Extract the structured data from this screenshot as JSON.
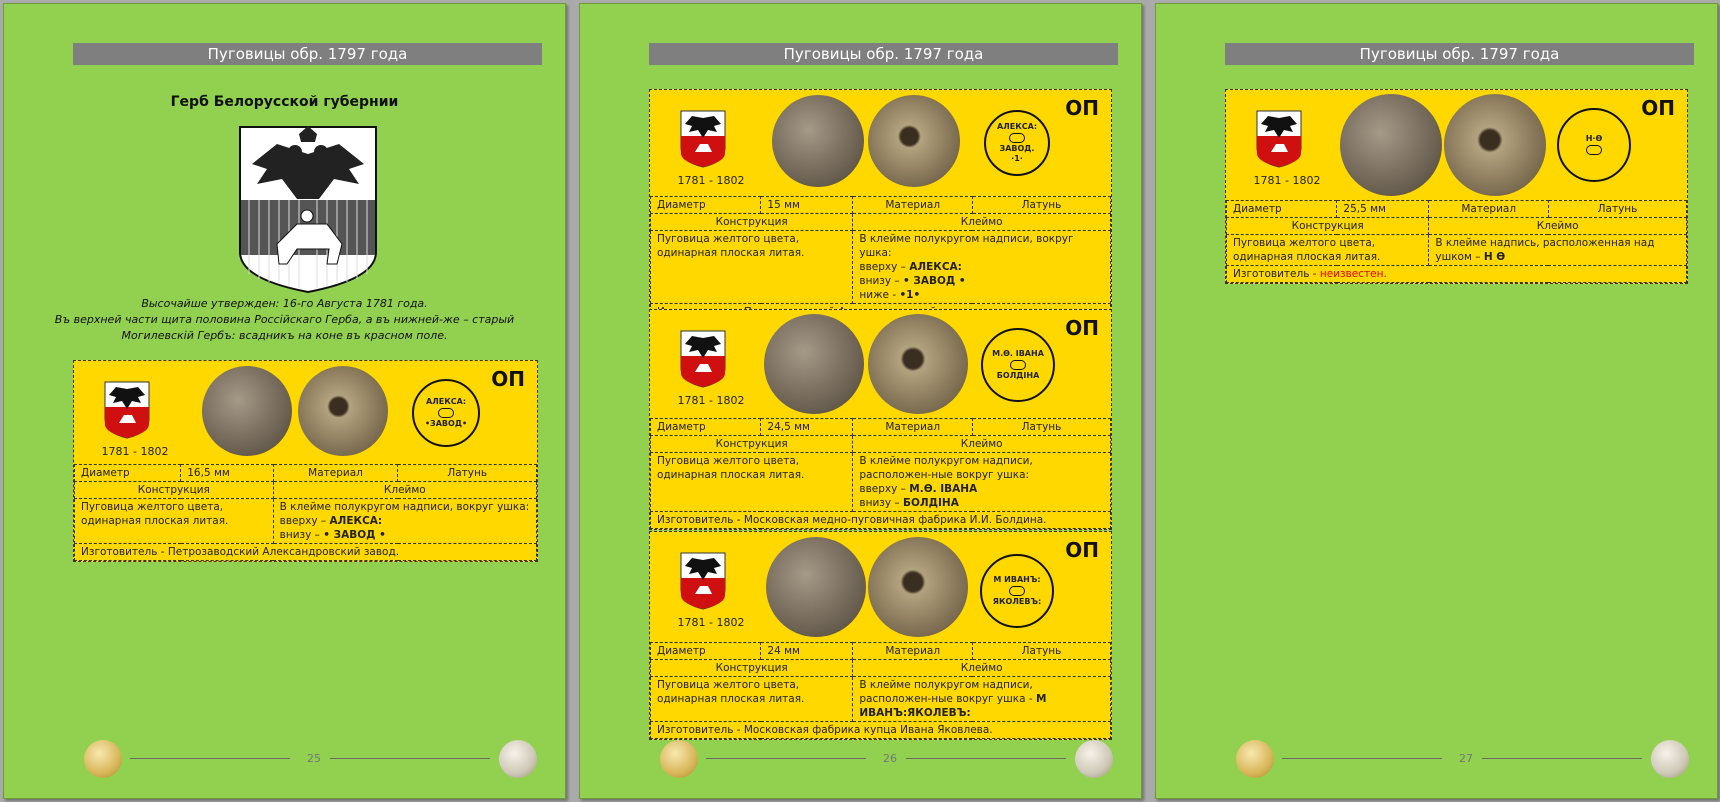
{
  "header": "Пуговицы обр. 1797 года",
  "p1": {
    "title": "Герб Белорусской губернии",
    "desc": [
      "Высочайше утвержден: 16-го Августа 1781 года.",
      "Въ верхней части щита половина Россійскаго Герба, а въ нижней-же – старый",
      "Могилевскій Гербъ: всадникъ на коне въ красном поле."
    ],
    "page": "25"
  },
  "p2": {
    "page": "26"
  },
  "p3": {
    "page": "27"
  },
  "lbl": {
    "op": "ОП",
    "years": "1781 - 1802",
    "diam": "Диаметр",
    "mat": "Материал",
    "brass": "Латунь",
    "constr": "Конструкция",
    "mark": "Клеймо",
    "constr_text": "Пуговица желтого цвета, одинарная плоская литая.",
    "maker": "Изготовитель - "
  },
  "cards": {
    "c1": {
      "diam": "16,5 мм",
      "m1": "В клейме полукругом надписи, вокруг ушка:",
      "m2a": "вверху – ",
      "m2b": "АЛЕКСА:",
      "m3a": "внизу – ",
      "m3b": "• ЗАВОД •",
      "maker": "Изготовитель - Петрозаводский Александровский завод.",
      "stamp1": "АЛЕКСА:",
      "stamp2": "•ЗАВОД•"
    },
    "c2": {
      "diam": "15 мм",
      "m1": "В клейме полукругом надписи, вокруг ушка:",
      "m2a": "вверху – ",
      "m2b": "АЛЕКСА:",
      "m3a": "внизу – ",
      "m3b": "• ЗАВОД •",
      "m4a": "ниже - ",
      "m4b": "•1•",
      "maker": "Изготовитель - Петрозаводский Александровский завод.",
      "stamp1": "АЛЕКСА:",
      "stamp2": "ЗАВОД.",
      "stamp3": "·1·"
    },
    "c3": {
      "diam": "24,5 мм",
      "m1": "В клейме полукругом надписи, расположен-ные вокруг ушка:",
      "m2a": "вверху – ",
      "m2b": "М.Ѳ. ІВАНА",
      "m3a": "внизу – ",
      "m3b": "БОЛДІНА",
      "maker": "Изготовитель - Московская медно-пуговичная фабрика И.И. Болдина.",
      "stamp1": "М.Ѳ. ІВАНА",
      "stamp2": "БОЛДІНА"
    },
    "c4": {
      "diam": "24 мм",
      "m1": "В клейме полукругом надписи, расположен-ные вокруг ушка - ",
      "m1b": "М ИВАНЪ:ЯКОЛЕВЪ:",
      "maker": "Изготовитель - Московская фабрика купца Ивана Яковлева.",
      "stamp1": "М ИВАНЪ:",
      "stamp2": "ЯКОЛЕВЪ:"
    },
    "c5": {
      "diam": "25,5 мм",
      "m1": "В клейме надпись, расположенная над ушком – ",
      "m1b": "Н Ѳ",
      "maker_a": "Изготовитель - ",
      "maker_b": "неизвестен.",
      "stamp1": "Н·Ѳ"
    }
  }
}
